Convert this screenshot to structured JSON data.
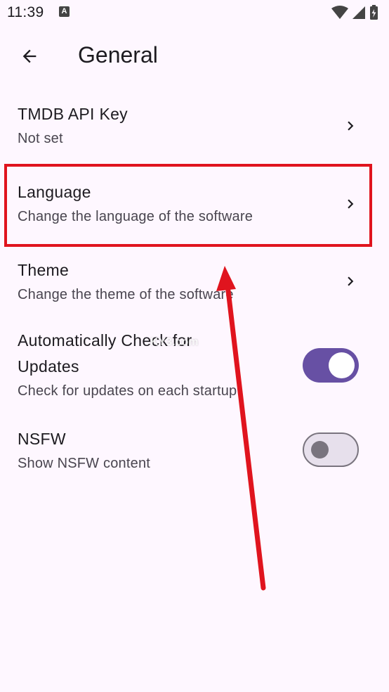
{
  "status_bar": {
    "time": "11:39",
    "notification_icon": "a-icon",
    "icons": [
      "wifi-icon",
      "signal-icon",
      "battery-icon"
    ]
  },
  "app_bar": {
    "back_icon": "arrow-left-icon",
    "title": "General"
  },
  "settings": [
    {
      "title": "TMDB API Key",
      "subtitle": "Not set",
      "trailing": "chevron-right-icon"
    },
    {
      "title": "Language",
      "subtitle": "Change the language of the software",
      "trailing": "chevron-right-icon"
    },
    {
      "title": "Theme",
      "subtitle": "Change the theme of the software",
      "trailing": "chevron-right-icon"
    },
    {
      "title_line1": "Automatically Check for",
      "title_line2": "Updates",
      "subtitle": "Check for updates on each startup",
      "trailing": "toggle-switch",
      "checked": true
    },
    {
      "title": "NSFW",
      "subtitle": "Show NSFW content",
      "trailing": "toggle-switch",
      "checked": false
    }
  ],
  "annotation": {
    "highlight_color": "#e0141e",
    "watermark": "KY3.com"
  },
  "colors": {
    "background": "#fef7ff",
    "switch_on": "#6750a4",
    "switch_off_track": "#e7e0ec",
    "switch_off_outline": "#79747e"
  }
}
